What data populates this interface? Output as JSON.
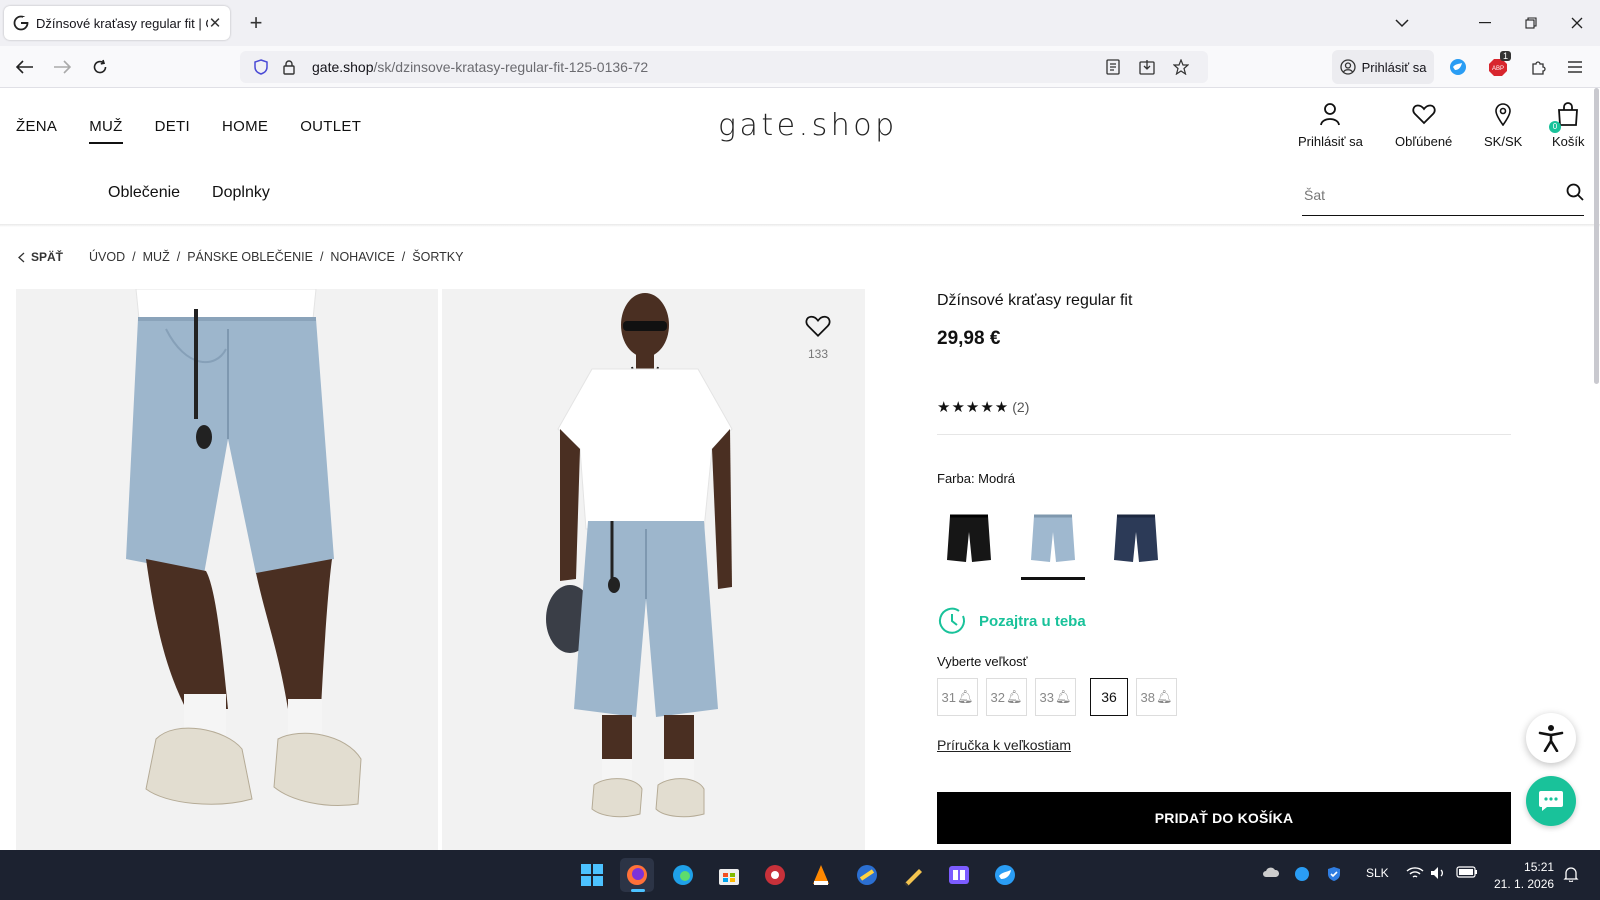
{
  "browser": {
    "tab_title": "Džínsové kraťasy regular fit | GA",
    "url_domain": "gate.shop",
    "url_path": "/sk/dzinsove-kratasy-regular-fit-125-0136-72",
    "account_label": "Prihlásiť sa",
    "extension_badge": "1"
  },
  "site": {
    "logo": "gate.shop",
    "nav": [
      "ŽENA",
      "MUŽ",
      "DETI",
      "HOME",
      "OUTLET"
    ],
    "active_nav": "MUŽ",
    "subnav": [
      "Oblečenie",
      "Doplnky"
    ],
    "header_actions": {
      "login": "Prihlásiť sa",
      "favorites": "Obľúbené",
      "locale": "SK/SK",
      "cart": "Košík",
      "cart_count": "0"
    },
    "search_placeholder": "Šat"
  },
  "breadcrumb": {
    "back": "SPÄŤ",
    "items": [
      "ÚVOD",
      "MUŽ",
      "PÁNSKE OBLEČENIE",
      "NOHAVICE",
      "ŠORTKY"
    ]
  },
  "product": {
    "title": "Džínsové kraťasy regular fit",
    "price": "29,98 €",
    "rating_count": "(2)",
    "rating_stars": 5,
    "wishlist_count": "133",
    "color_label": "Farba: Modrá",
    "colors": [
      {
        "name": "čierna",
        "hex": "#1a1a1a",
        "selected": false
      },
      {
        "name": "modrá",
        "hex": "#9fb8cf",
        "selected": true
      },
      {
        "name": "tmavomodrá",
        "hex": "#2c3a57",
        "selected": false
      }
    ],
    "delivery": "Pozajtra u teba",
    "size_label": "Vyberte veľkosť",
    "sizes": [
      {
        "label": "31",
        "available": false
      },
      {
        "label": "32",
        "available": false
      },
      {
        "label": "33",
        "available": false
      },
      {
        "label": "36",
        "available": true
      },
      {
        "label": "38",
        "available": false
      }
    ],
    "size_guide": "Príručka k veľkostiam",
    "add_to_cart": "PRIDAŤ DO KOŠÍKA"
  },
  "colors": {
    "accent": "#19c29a",
    "taskbar": "#1c2230"
  },
  "taskbar": {
    "lang": "SLK",
    "time": "15:21",
    "date": "21. 1. 2026"
  }
}
